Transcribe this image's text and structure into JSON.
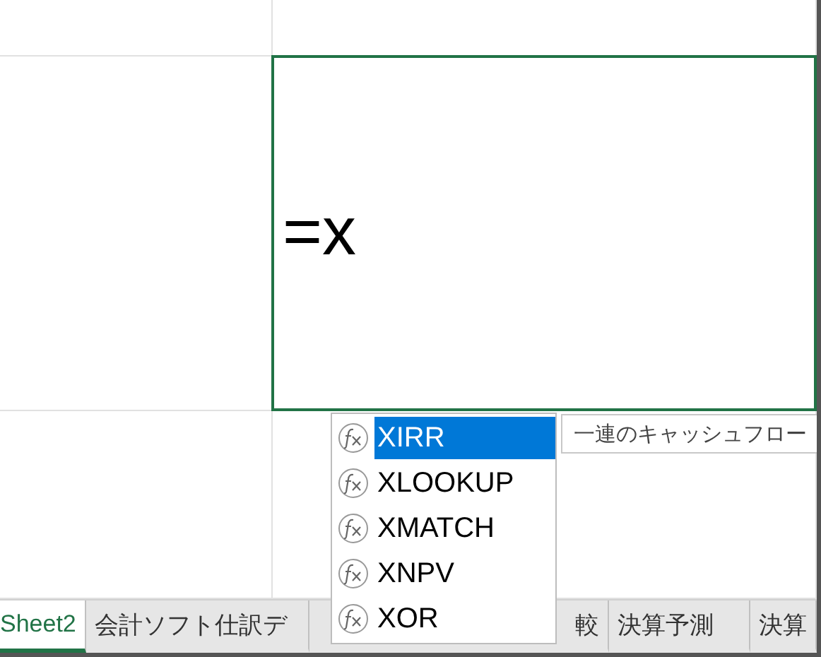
{
  "cell": {
    "content": "=x"
  },
  "autocomplete": {
    "items": [
      {
        "label": "XIRR",
        "selected": true
      },
      {
        "label": "XLOOKUP",
        "selected": false
      },
      {
        "label": "XMATCH",
        "selected": false
      },
      {
        "label": "XNPV",
        "selected": false
      },
      {
        "label": "XOR",
        "selected": false
      }
    ]
  },
  "tooltip": {
    "text": "一連のキャッシュフロー"
  },
  "sheet_tabs": [
    {
      "label": "Sheet2",
      "selected": true
    },
    {
      "label": "会計ソフト仕訳デ",
      "selected": false
    },
    {
      "label": "較",
      "selected": false
    },
    {
      "label": "決算予測",
      "selected": false
    },
    {
      "label": "決算",
      "selected": false
    }
  ]
}
